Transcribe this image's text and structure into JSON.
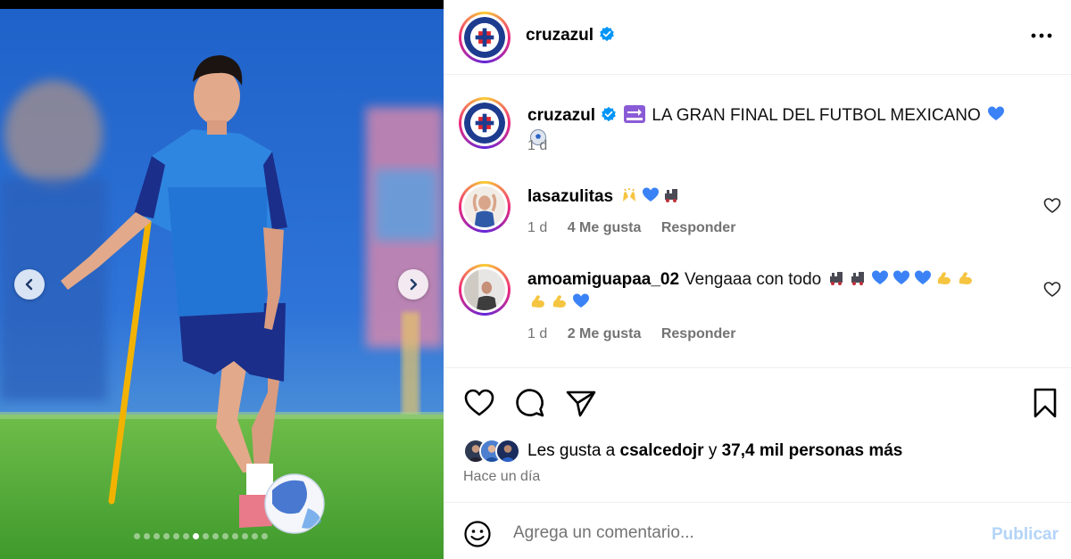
{
  "post": {
    "username": "cruzazul",
    "caption": "LA GRAN FINAL DEL FUTBOL MEXICANO",
    "caption_time": "1 d",
    "more_icon": "more-horizontal-icon"
  },
  "media": {
    "current_slide": 6,
    "total_slides": 14,
    "photo_description_icon": "soccer-player-photo"
  },
  "comments": [
    {
      "username": "lasazulitas",
      "text": "",
      "time": "1 d",
      "likes": "4 Me gusta",
      "reply": "Responder"
    },
    {
      "username": "amoamiguapaa_02",
      "text": "Vengaaa con todo",
      "time": "1 d",
      "likes": "2 Me gusta",
      "reply": "Responder"
    }
  ],
  "likes": {
    "prefix": "Les gusta a",
    "user": "csalcedojr",
    "connector": "y",
    "others": "37,4 mil personas más"
  },
  "time_ago": "Hace un día",
  "comment_box": {
    "placeholder": "Agrega un comentario...",
    "publish_label": "Publicar"
  },
  "colors": {
    "verified_blue": "#0095f6",
    "publish_disabled": "#b3d4f7",
    "meta_gray": "#737373"
  }
}
